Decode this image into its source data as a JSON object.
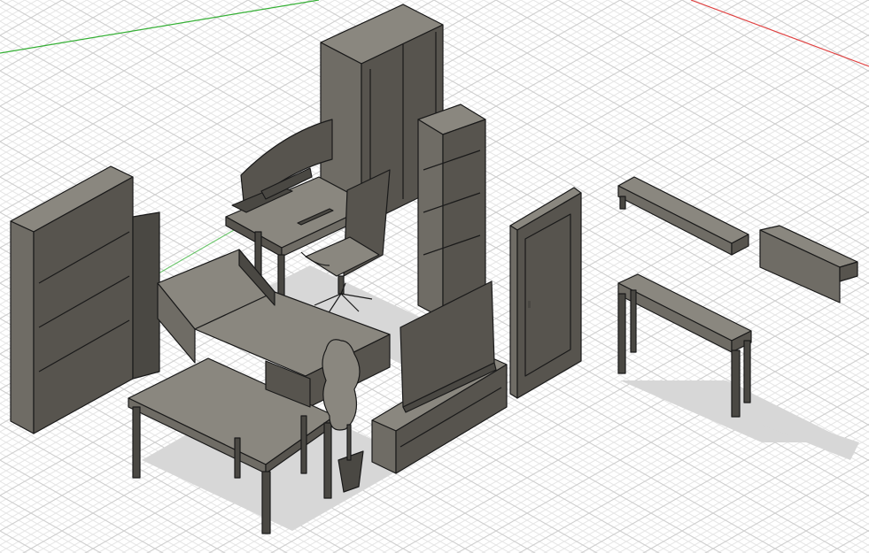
{
  "viewport": {
    "background": "#ffffff",
    "grid_minor_color": "#e6e6e6",
    "grid_major_color": "#cfcfcf",
    "axis_x_color": "#e04040",
    "axis_y_color": "#35b035",
    "model_colors": {
      "top": "#8a877f",
      "left": "#6f6c65",
      "right": "#57544e",
      "edge": "#1a1a1a"
    }
  },
  "scene": {
    "objects": [
      "wardrobe",
      "computer-desk",
      "curved-monitor",
      "office-chair",
      "tall-shelf-left",
      "tall-shelf-center",
      "bed",
      "dining-table",
      "dining-chair",
      "tv-stand",
      "television",
      "potted-plant",
      "door",
      "wall-shelf-long",
      "wall-shelf-short",
      "console-table"
    ]
  }
}
